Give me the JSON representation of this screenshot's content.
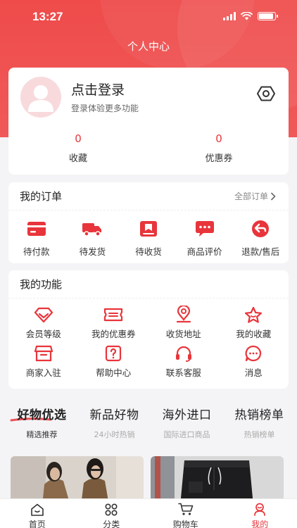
{
  "status": {
    "time": "13:27",
    "battery_level": 0.9
  },
  "header": {
    "title": "个人中心"
  },
  "user": {
    "login_title": "点击登录",
    "login_subtitle": "登录体验更多功能",
    "stats": [
      {
        "value": "0",
        "label": "收藏"
      },
      {
        "value": "0",
        "label": "优惠券"
      }
    ]
  },
  "orders": {
    "title": "我的订单",
    "all_label": "全部订单",
    "items": [
      {
        "label": "待付款",
        "icon": "card-icon"
      },
      {
        "label": "待发货",
        "icon": "truck-icon"
      },
      {
        "label": "待收货",
        "icon": "package-icon"
      },
      {
        "label": "商品评价",
        "icon": "comment-icon"
      },
      {
        "label": "退款/售后",
        "icon": "return-icon"
      }
    ]
  },
  "functions": {
    "title": "我的功能",
    "items": [
      {
        "label": "会员等级",
        "icon": "diamond-icon"
      },
      {
        "label": "我的优惠券",
        "icon": "ticket-icon"
      },
      {
        "label": "收货地址",
        "icon": "location-icon"
      },
      {
        "label": "我的收藏",
        "icon": "star-icon"
      },
      {
        "label": "商家入驻",
        "icon": "store-icon"
      },
      {
        "label": "帮助中心",
        "icon": "help-icon"
      },
      {
        "label": "联系客服",
        "icon": "headset-icon"
      },
      {
        "label": "消息",
        "icon": "message-icon"
      }
    ]
  },
  "feed_tabs": [
    {
      "title": "好物优选",
      "subtitle": "精选推荐",
      "active": true
    },
    {
      "title": "新品好物",
      "subtitle": "24小时热销",
      "active": false
    },
    {
      "title": "海外进口",
      "subtitle": "国际进口商品",
      "active": false
    },
    {
      "title": "热销榜单",
      "subtitle": "热销榜单",
      "active": false
    }
  ],
  "tabbar": [
    {
      "label": "首页",
      "icon": "home-icon",
      "active": false
    },
    {
      "label": "分类",
      "icon": "grid-icon",
      "active": false
    },
    {
      "label": "购物车",
      "icon": "cart-icon",
      "active": false
    },
    {
      "label": "我的",
      "icon": "profile-icon",
      "active": true
    }
  ],
  "colors": {
    "brand": "#e8353b",
    "hero": "#ef4b4b",
    "background": "#f4f4f6"
  }
}
